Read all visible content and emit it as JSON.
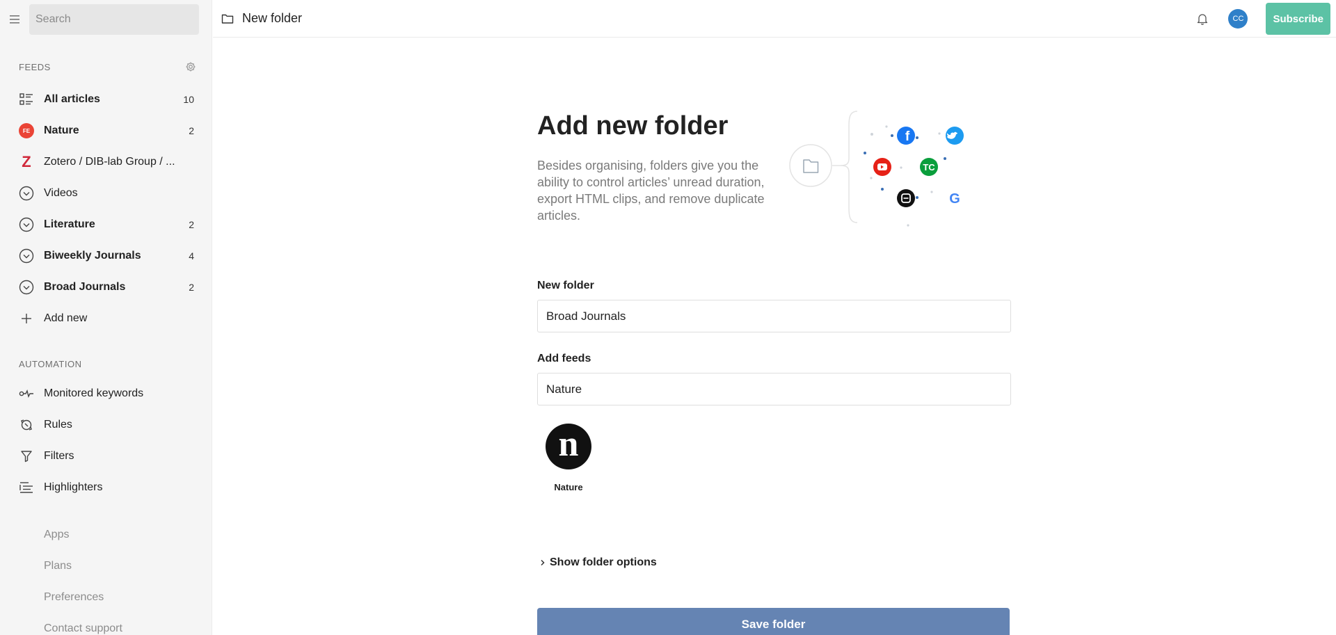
{
  "sidebar": {
    "search_placeholder": "Search",
    "feeds_heading": "FEEDS",
    "feeds": [
      {
        "label": "All articles",
        "count": "10",
        "icon": "all-articles-icon"
      },
      {
        "label": "Nature",
        "count": "2",
        "icon": "fe-badge-icon",
        "badge": "FE"
      },
      {
        "label": "Zotero / DIB-lab Group / ...",
        "count": "",
        "icon": "zotero-icon",
        "badge": "Z"
      },
      {
        "label": "Videos",
        "count": "",
        "icon": "folder-collapse-icon"
      },
      {
        "label": "Literature",
        "count": "2",
        "icon": "folder-collapse-icon"
      },
      {
        "label": "Biweekly Journals",
        "count": "4",
        "icon": "folder-collapse-icon"
      },
      {
        "label": "Broad Journals",
        "count": "2",
        "icon": "folder-collapse-icon"
      },
      {
        "label": "Add new",
        "count": "",
        "icon": "plus-icon"
      }
    ],
    "automation_heading": "AUTOMATION",
    "automation": [
      {
        "label": "Monitored keywords",
        "icon": "keywords-icon"
      },
      {
        "label": "Rules",
        "icon": "rules-icon"
      },
      {
        "label": "Filters",
        "icon": "filter-icon"
      },
      {
        "label": "Highlighters",
        "icon": "highlighter-icon"
      }
    ],
    "links": [
      "Apps",
      "Plans",
      "Preferences",
      "Contact support"
    ]
  },
  "header": {
    "title": "New folder",
    "avatar_initials": "CC",
    "subscribe_label": "Subscribe"
  },
  "main": {
    "title": "Add new folder",
    "description": "Besides organising, folders give you the ability to control articles’ unread duration, export HTML clips, and remove duplicate articles.",
    "folder_label": "New folder",
    "folder_value": "Broad Journals",
    "feeds_label": "Add feeds",
    "feeds_value": "Nature",
    "selected_feed": {
      "name": "Nature",
      "logo_letter": "n"
    },
    "options_label": "Show folder options",
    "save_label": "Save folder"
  },
  "colors": {
    "sidebar_bg": "#f5f5f5",
    "subscribe": "#5cc2a5",
    "avatar": "#2f80c9",
    "save_button": "#6584b3",
    "badge_red": "#ea4436"
  }
}
